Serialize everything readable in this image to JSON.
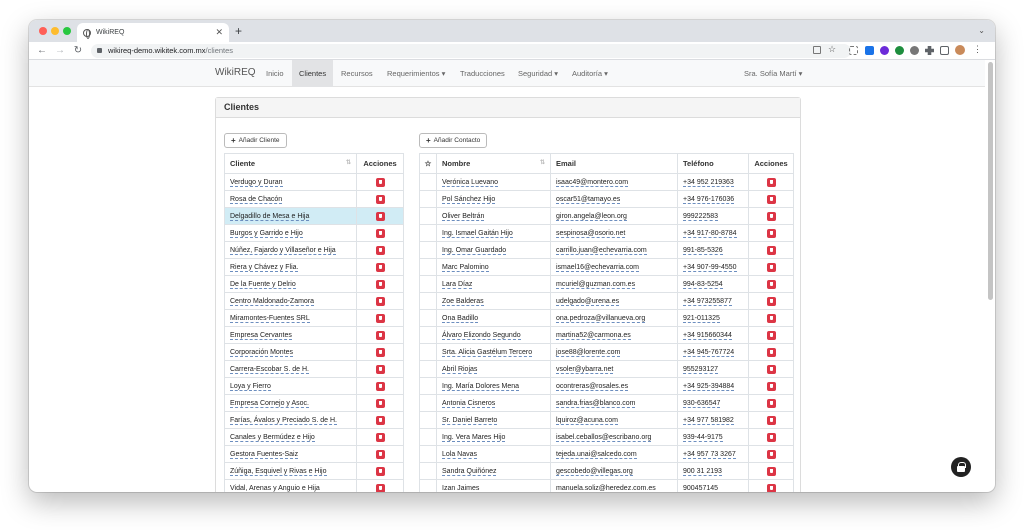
{
  "browser": {
    "tab_title": "WikiREQ",
    "url_host": "wikireq-demo.wikitek.com.mx",
    "url_path": "/clientes"
  },
  "nav": {
    "brand": "WikiREQ",
    "items": [
      {
        "label": "Inicio"
      },
      {
        "label": "Clientes",
        "active": true
      },
      {
        "label": "Recursos"
      },
      {
        "label": "Requerimientos ▾"
      },
      {
        "label": "Traducciones"
      },
      {
        "label": "Seguridad ▾"
      },
      {
        "label": "Auditoría ▾"
      }
    ],
    "user": "Sra. Sofía Martí ▾"
  },
  "panel": {
    "title": "Clientes",
    "add_client": "Añadir Cliente",
    "add_contact": "Añadir Contacto"
  },
  "clients": {
    "headers": {
      "name": "Cliente",
      "actions": "Acciones"
    },
    "rows": [
      "Verdugo y Duran",
      "Rosa de Chacón",
      "Delgadillo de Mesa e Hija",
      "Burgos y Garrido e Hijo",
      "Núñez, Fajardo y Villaseñor e Hija",
      "Riera y Chávez y Flia.",
      "De la Fuente y Delrio",
      "Centro Maldonado-Zamora",
      "Miramontes-Fuentes SRL",
      "Empresa Cervantes",
      "Corporación Montes",
      "Carrera-Escobar S. de H.",
      "Loya y Fierro",
      "Empresa Cornejo y Asoc.",
      "Farías, Ávalos y Preciado S. de H.",
      "Canales y Bermúdez e Hijo",
      "Gestora Fuentes-Saiz",
      "Zúñiga, Esquivel y Rivas e Hijo",
      "Vidal, Arenas y Anguio e Hija"
    ],
    "selected_index": 2
  },
  "contacts": {
    "headers": {
      "star": "☆",
      "name": "Nombre",
      "email": "Email",
      "phone": "Teléfono",
      "actions": "Acciones"
    },
    "rows": [
      {
        "name": "Verónica Luevano",
        "email": "isaac49@montero.com",
        "phone": "+34 952 219363"
      },
      {
        "name": "Pol Sánchez Hijo",
        "email": "oscar51@tamayo.es",
        "phone": "+34 976-176036"
      },
      {
        "name": "Oliver Beltrán",
        "email": "giron.angela@leon.org",
        "phone": "999222583"
      },
      {
        "name": "Ing. Ismael Gaitán Hijo",
        "email": "sespinosa@osorio.net",
        "phone": "+34 917-80-8784"
      },
      {
        "name": "Ing. Omar Guardado",
        "email": "carrillo.juan@echevarria.com",
        "phone": "991-85-5326"
      },
      {
        "name": "Marc Palomino",
        "email": "ismael16@echevarria.com",
        "phone": "+34 907-99-4550"
      },
      {
        "name": "Lara Díaz",
        "email": "mcuriel@guzman.com.es",
        "phone": "994-83-5254"
      },
      {
        "name": "Zoe Balderas",
        "email": "udelgado@urena.es",
        "phone": "+34 973255877"
      },
      {
        "name": "Ona Badillo",
        "email": "ona.pedroza@villanueva.org",
        "phone": "921-011325"
      },
      {
        "name": "Álvaro Elizondo Segundo",
        "email": "martina52@carmona.es",
        "phone": "+34 915660344"
      },
      {
        "name": "Srta. Alicia Gastélum Tercero",
        "email": "jose88@lorente.com",
        "phone": "+34 945-767724"
      },
      {
        "name": "Abril Riojas",
        "email": "vsoler@ybarra.net",
        "phone": "955293127"
      },
      {
        "name": "Ing. María Dolores Mena",
        "email": "ocontreras@rosales.es",
        "phone": "+34 925-394884"
      },
      {
        "name": "Antonia Cisneros",
        "email": "sandra.frias@blanco.com",
        "phone": "930-636547"
      },
      {
        "name": "Sr. Daniel Barreto",
        "email": "lquiroz@acuna.com",
        "phone": "+34 977 581982"
      },
      {
        "name": "Ing. Vera Mares Hijo",
        "email": "isabel.ceballos@escribano.org",
        "phone": "939-44-9175"
      },
      {
        "name": "Lola Navas",
        "email": "tejeda.unai@salcedo.com",
        "phone": "+34 957 73 3267"
      },
      {
        "name": "Sandra Quiñónez",
        "email": "gescobedo@villegas.org",
        "phone": "900 31 2193"
      },
      {
        "name": "Izan Jaimes",
        "email": "manuela.soliz@heredez.com.es",
        "phone": "900457145"
      }
    ]
  },
  "colors": {
    "delete": "#dc3545",
    "selected_row": "#d1ecf5",
    "link_underline": "#6c8ebf"
  }
}
